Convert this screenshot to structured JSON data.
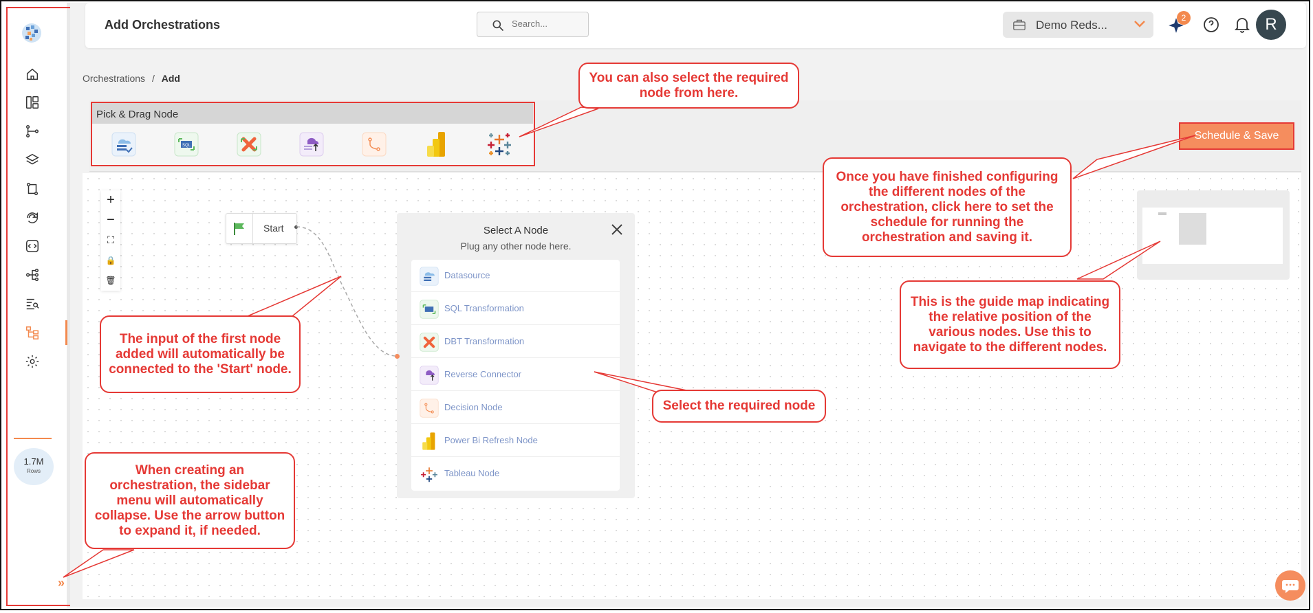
{
  "header": {
    "title": "Add Orchestrations",
    "search_placeholder": "Search...",
    "workspace": "Demo Reds...",
    "notification_count": "2",
    "avatar_initial": "R"
  },
  "breadcrumb": {
    "parent": "Orchestrations",
    "separator": "/",
    "current": "Add"
  },
  "sidebar": {
    "items": [
      {
        "name": "home-icon"
      },
      {
        "name": "dashboard-icon"
      },
      {
        "name": "pipeline-icon"
      },
      {
        "name": "layers-icon"
      },
      {
        "name": "transform-icon"
      },
      {
        "name": "sync-icon"
      },
      {
        "name": "code-icon"
      },
      {
        "name": "lineage-icon"
      },
      {
        "name": "query-icon"
      },
      {
        "name": "orchestration-icon",
        "active": true
      },
      {
        "name": "settings-icon"
      }
    ],
    "rows_count": "1.7M",
    "rows_label": "Rows"
  },
  "toolbar": {
    "pick_title": "Pick & Drag Node",
    "schedule_label": "Schedule & Save"
  },
  "canvas": {
    "zoom": [
      "+",
      "−",
      "⛶",
      "🔒",
      "🗑"
    ],
    "start_label": "Start"
  },
  "select_node": {
    "title": "Select A Node",
    "subtitle": "Plug any other node here.",
    "items": [
      {
        "label": "Datasource",
        "icon": "datasource-icon"
      },
      {
        "label": "SQL Transformation",
        "icon": "sql-icon"
      },
      {
        "label": "DBT Transformation",
        "icon": "dbt-icon"
      },
      {
        "label": "Reverse Connector",
        "icon": "reverse-connector-icon"
      },
      {
        "label": "Decision Node",
        "icon": "decision-icon"
      },
      {
        "label": "Power Bi Refresh Node",
        "icon": "powerbi-icon"
      },
      {
        "label": "Tableau Node",
        "icon": "tableau-icon"
      }
    ]
  },
  "callouts": {
    "pick_node": "You can also select the required node from here.",
    "schedule": "Once you have finished configuring the different nodes of the orchestration, click here to set the schedule for running the orchestration and saving it.",
    "minimap": "This is the guide map indicating the relative position of the various nodes. Use this to navigate to the different nodes.",
    "start": "The input of the first node added will automatically be connected to the 'Start' node.",
    "select": "Select the required node",
    "sidebar": "When creating an orchestration, the sidebar menu will automatically collapse. Use the arrow button to expand it, if needed."
  },
  "colors": {
    "accent": "#f3894e",
    "annotation": "#e53935",
    "link": "#7e95c8"
  }
}
